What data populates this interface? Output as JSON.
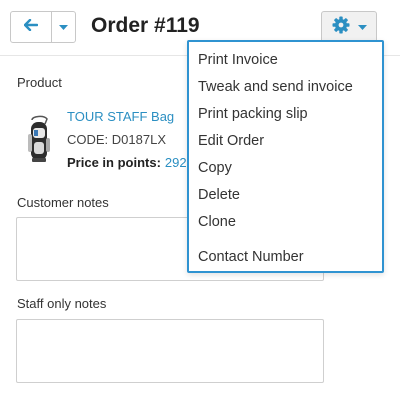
{
  "header": {
    "title": "Order #119",
    "back_icon": "arrow-left-icon",
    "chevron_icon": "chevron-down-icon",
    "gear_icon": "gear-icon"
  },
  "product": {
    "section_label": "Product",
    "name": "TOUR STAFF Bag",
    "code": "CODE: D0187LX",
    "points_label": "Price in points:",
    "points_value": "292"
  },
  "notes": {
    "customer_label": "Customer notes",
    "customer_value": "",
    "staff_label": "Staff only notes",
    "staff_value": ""
  },
  "menu": {
    "items": [
      "Print Invoice",
      "Tweak and send invoice",
      "Print packing slip",
      "Edit Order",
      "Copy",
      "Delete",
      "Clone",
      "Contact Number"
    ]
  },
  "colors": {
    "accent": "#2f93d1",
    "link": "#2b8fc2"
  }
}
